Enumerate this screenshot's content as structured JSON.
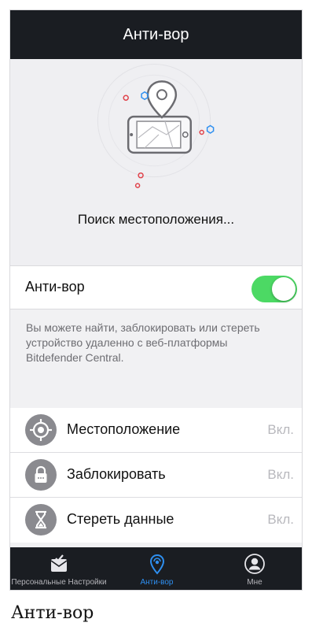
{
  "navbar": {
    "title": "Анти-вор"
  },
  "locate": {
    "status_text": "Поиск местоположения..."
  },
  "toggle_row": {
    "label": "Анти-вор",
    "enabled": true
  },
  "description": "Вы можете найти, заблокировать или стереть устройство удаленно с веб-платформы Bitdefender Central.",
  "features": [
    {
      "icon": "target-icon",
      "label": "Местоположение",
      "state": "Вкл."
    },
    {
      "icon": "lock-icon",
      "label": "Заблокировать",
      "state": "Вкл."
    },
    {
      "icon": "hourglass-icon",
      "label": "Стереть данные",
      "state": "Вкл."
    }
  ],
  "tabbar": {
    "tabs": [
      {
        "icon": "personal-settings-icon",
        "label": "Персональные Настройки",
        "active": false
      },
      {
        "icon": "antitheft-location-icon",
        "label": "Анти-вор",
        "active": true
      },
      {
        "icon": "user-icon",
        "label": "Мне",
        "active": false
      }
    ]
  },
  "caption": "Анти-вор",
  "colors": {
    "accent_blue": "#2e8ff0",
    "toggle_green": "#4cd964",
    "dark_bar": "#1a1d22"
  }
}
